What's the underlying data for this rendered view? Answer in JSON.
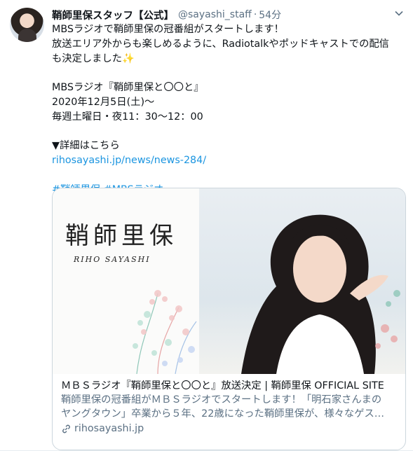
{
  "tweet": {
    "display_name": "鞘師里保スタッフ【公式】",
    "handle": "@sayashi_staff",
    "separator": "·",
    "time": "54分",
    "lines": [
      "MBSラジオで鞘師里保の冠番組がスタートします！",
      "放送エリア外からも楽しめるように、Radiotalkやポッドキャストでの配信",
      "も決定しました"
    ],
    "program_title": "MBSラジオ『鞘師里保と〇〇と』",
    "date": "2020年12月5日(土)〜",
    "schedule": "毎週土曜日・夜11：30〜12：00",
    "details_label": "▼詳細はこちら",
    "url": "rihosayashi.jp/news/news-284/",
    "hashtags": [
      "#鞘師里保",
      "#MBSラジオ"
    ]
  },
  "card": {
    "calligraphy": "鞘師里保",
    "name_roman": "RIHO SAYASHI",
    "title": "ＭＢＳラジオ『鞘師里保と〇〇と』放送決定 | 鞘師里保 OFFICIAL SITE",
    "description_lines": [
      "鞘師里保の冠番組がＭＢＳラジオでスタートします！「明石家さんまの",
      "ヤングタウン」卒業から５年、22歳になった鞘師里保が、様々なゲス…"
    ],
    "domain": "rihosayashi.jp"
  },
  "icons": {
    "more": "chevron-down-icon",
    "link": "link-icon",
    "sparkle": "sparkles-emoji"
  },
  "colors": {
    "link": "#1b95e0",
    "secondary": "#5b7083",
    "border": "#ccd6dd"
  }
}
